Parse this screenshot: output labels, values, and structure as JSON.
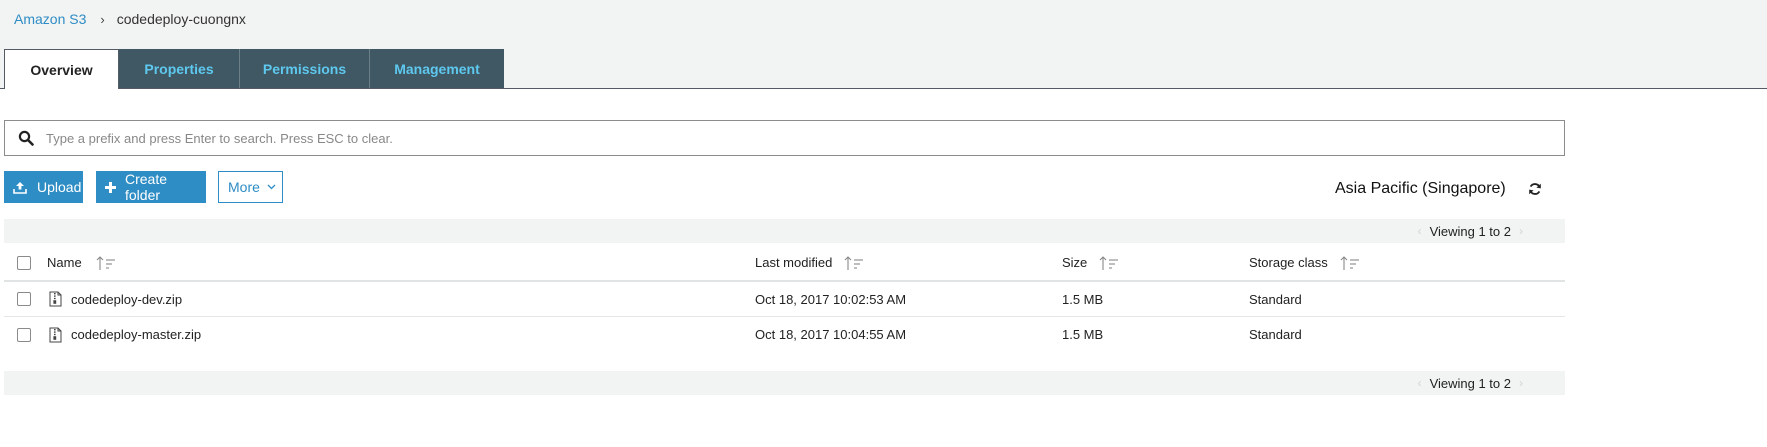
{
  "breadcrumb": {
    "root": "Amazon S3",
    "separator": "›",
    "current": "codedeploy-cuongnx"
  },
  "tabs": [
    {
      "label": "Overview",
      "active": true
    },
    {
      "label": "Properties",
      "active": false
    },
    {
      "label": "Permissions",
      "active": false
    },
    {
      "label": "Management",
      "active": false
    }
  ],
  "search": {
    "placeholder": "Type a prefix and press Enter to search. Press ESC to clear.",
    "value": "",
    "icon": "search-icon"
  },
  "toolbar": {
    "upload_label": "Upload",
    "create_folder_label": "Create folder",
    "more_label": "More",
    "region": "Asia Pacific (Singapore)"
  },
  "pager": {
    "top_text": "Viewing 1 to 2",
    "bottom_text": "Viewing 1 to 2",
    "prev": "‹",
    "next": "›"
  },
  "table": {
    "columns": [
      "Name",
      "Last modified",
      "Size",
      "Storage class"
    ],
    "rows": [
      {
        "name": "codedeploy-dev.zip",
        "last_modified": "Oct 18, 2017 10:02:53 AM",
        "size": "1.5 MB",
        "storage_class": "Standard"
      },
      {
        "name": "codedeploy-master.zip",
        "last_modified": "Oct 18, 2017 10:04:55 AM",
        "size": "1.5 MB",
        "storage_class": "Standard"
      }
    ]
  },
  "colors": {
    "accent": "#2e8dc4",
    "tab_bg": "#3f5864",
    "tab_text": "#5ec8ee",
    "panel_bg": "#ffffff",
    "page_bg": "#f2f3f3"
  }
}
